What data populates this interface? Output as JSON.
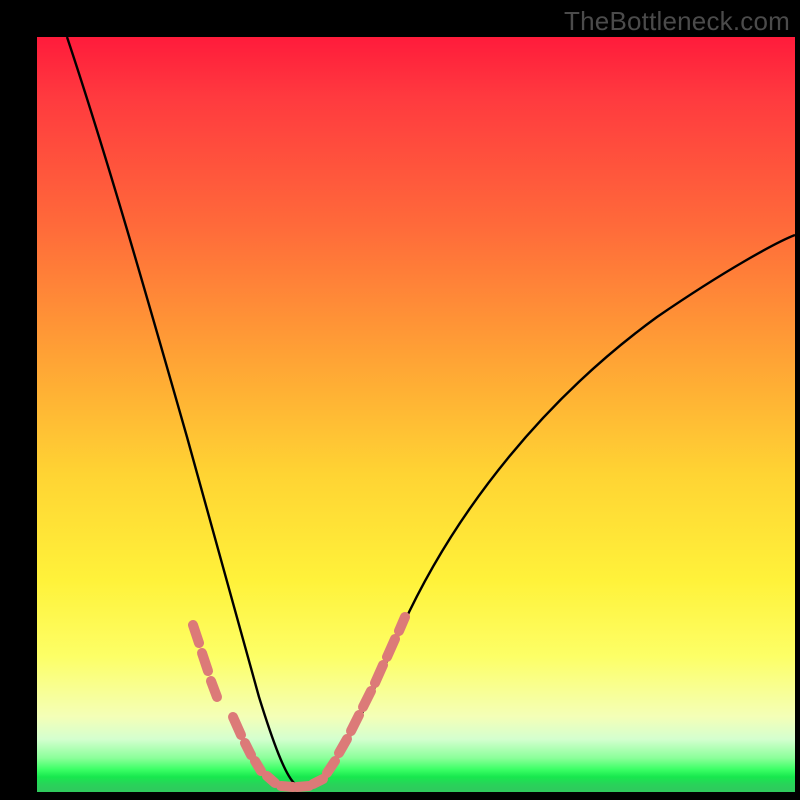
{
  "watermark": "TheBottleneck.com",
  "colors": {
    "frame": "#000000",
    "curve": "#000000",
    "marker": "#dc7a78",
    "gradient_top": "#ff1b3b",
    "gradient_bottom": "#2fc95d"
  },
  "chart_data": {
    "type": "line",
    "title": "",
    "xlabel": "",
    "ylabel": "",
    "xlim": [
      0,
      100
    ],
    "ylim": [
      0,
      100
    ],
    "note": "Axes are unlabeled in the source image; x and y are normalized to 0–100 based on pixel position. Curve is a V-shaped bottleneck chart with minimum near x≈34, y≈1.",
    "series": [
      {
        "name": "bottleneck-curve",
        "x": [
          4,
          8,
          12,
          16,
          20,
          23,
          26,
          28,
          30,
          32,
          34,
          36,
          38,
          41,
          44,
          48,
          53,
          60,
          70,
          82,
          96
        ],
        "y": [
          100,
          87,
          75,
          63,
          51,
          41,
          32,
          24,
          16,
          8,
          1,
          1,
          6,
          12,
          18,
          25,
          33,
          42,
          53,
          63,
          72
        ]
      }
    ],
    "markers": {
      "name": "highlighted-points",
      "note": "Coral dotted segments near the valley on both branches.",
      "x": [
        20.5,
        21.5,
        22.5,
        23.5,
        25.5,
        27.0,
        28.5,
        30.0,
        31.0,
        32.5,
        33.5,
        35.0,
        36.5,
        38.0,
        39.0,
        40.0,
        41.0,
        42.5,
        43.5,
        45.0,
        46.5
      ],
      "y": [
        22.0,
        20.0,
        18.0,
        16.0,
        11.0,
        8.0,
        6.0,
        4.0,
        2.0,
        1.2,
        1.0,
        1.0,
        1.6,
        3.5,
        5.5,
        7.5,
        9.5,
        12.0,
        14.0,
        17.0,
        20.0
      ]
    }
  }
}
